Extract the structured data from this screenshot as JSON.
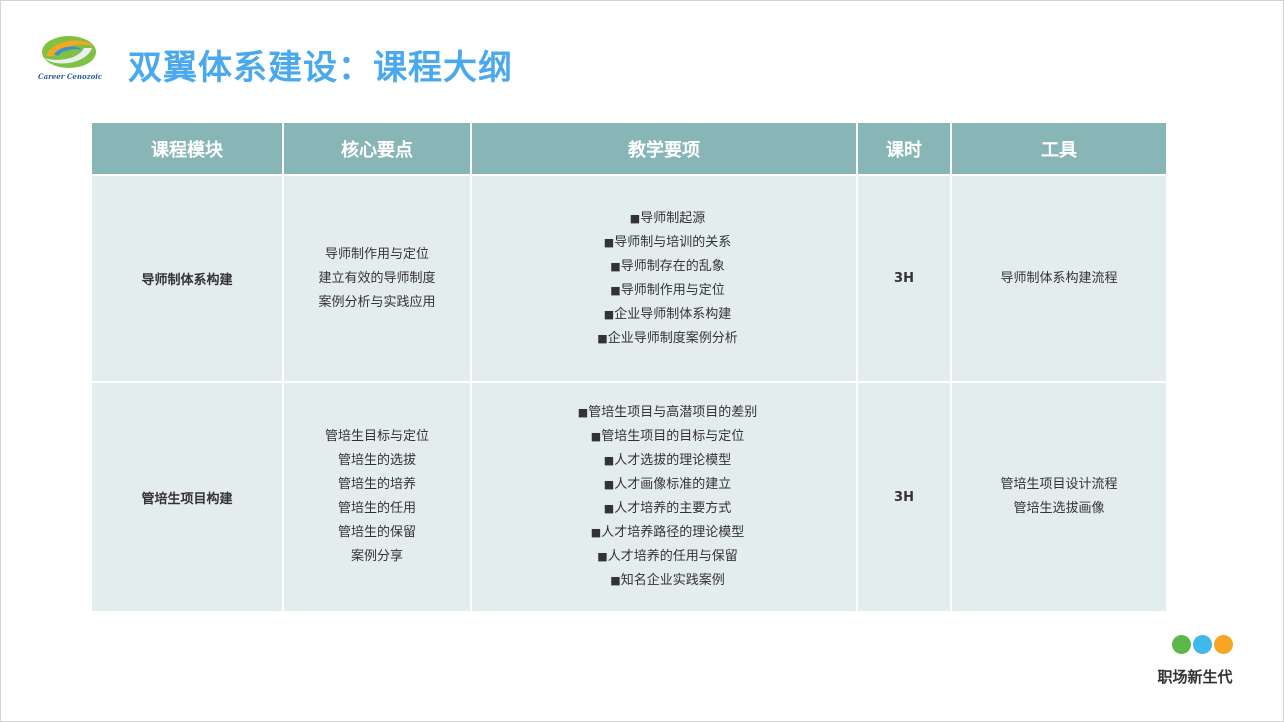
{
  "header": {
    "title": "双翼体系建设：课程大纲",
    "logo_text": "Career Cenozoic",
    "logo_icon": "swirl-logo-icon",
    "title_color": "#4aa8ee"
  },
  "table": {
    "header_color": "#88b6b6",
    "cell_color": "#e4eded",
    "columns": [
      "课程模块",
      "核心要点",
      "教学要项",
      "课时",
      "工具"
    ],
    "rows": [
      {
        "module": "导师制体系构建",
        "key_points": [
          "导师制作用与定位",
          "建立有效的导师制度",
          "案例分析与实践应用"
        ],
        "teaching_items": [
          "导师制起源",
          "导师制与培训的关系",
          "导师制存在的乱象",
          "导师制作用与定位",
          "企业导师制体系构建",
          "企业导师制度案例分析"
        ],
        "hours": "3H",
        "tools": [
          "导师制体系构建流程"
        ]
      },
      {
        "module": "管培生项目构建",
        "key_points": [
          "管培生目标与定位",
          "管培生的选拔",
          "管培生的培养",
          "管培生的任用",
          "管培生的保留",
          "案例分享"
        ],
        "teaching_items": [
          "管培生项目与高潜项目的差别",
          "管培生项目的目标与定位",
          "人才选拔的理论模型",
          "人才画像标准的建立",
          "人才培养的主要方式",
          "人才培养路径的理论模型",
          "人才培养的任用与保留",
          "知名企业实践案例"
        ],
        "hours": "3H",
        "tools": [
          "管培生项目设计流程",
          "管培生选拔画像"
        ]
      }
    ],
    "bullet_glyph": "■"
  },
  "footer": {
    "brand": "职场新生代",
    "dot_colors": [
      "#5cb84a",
      "#43b6ec",
      "#f6a623"
    ]
  }
}
